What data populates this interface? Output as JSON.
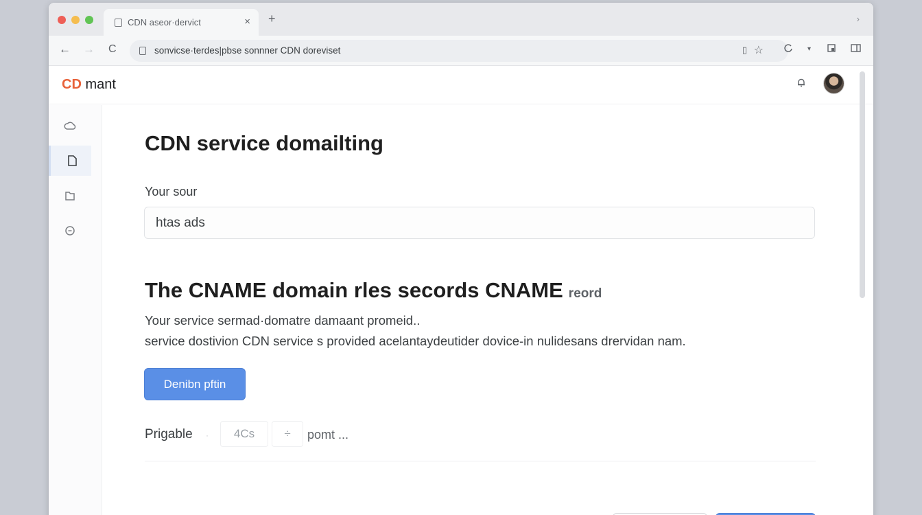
{
  "browser": {
    "tab_title": "CDN aseor·dervict",
    "tab_close": "×",
    "new_tab": "+",
    "tabstrip_menu": "›",
    "url": "sonvicse·terdes|pbse sonnner CDN doreviset",
    "bookmark_glyph": "▯",
    "star_glyph": "☆"
  },
  "app": {
    "brand_prefix": "CD",
    "brand_name": "mant",
    "brand_color": "#e8623a"
  },
  "page": {
    "title": "CDN service domailting",
    "source_label": "Your sour",
    "source_value": "htas ads",
    "section_title": "The CNAME domain rles secords CNAME",
    "section_tag": "reord",
    "desc_line1": "Your service sermad·domatre damaant promeid..",
    "desc_line2": "service dostivion CDN service s provided acelantaydeutider dovice-in nulidesans drervidan nam.",
    "primary_button": "Denibn pftin",
    "accent_color": "#5a8fe6"
  },
  "pagination": {
    "label": "Prigable",
    "separator": "·",
    "count": "4Cs",
    "step_glyph": "÷",
    "more": "pomt ..."
  },
  "icons": {
    "sidebar": [
      "cloud-icon",
      "document-icon",
      "folder-icon",
      "chat-icon"
    ],
    "header": [
      "bell-icon",
      "avatar"
    ]
  }
}
